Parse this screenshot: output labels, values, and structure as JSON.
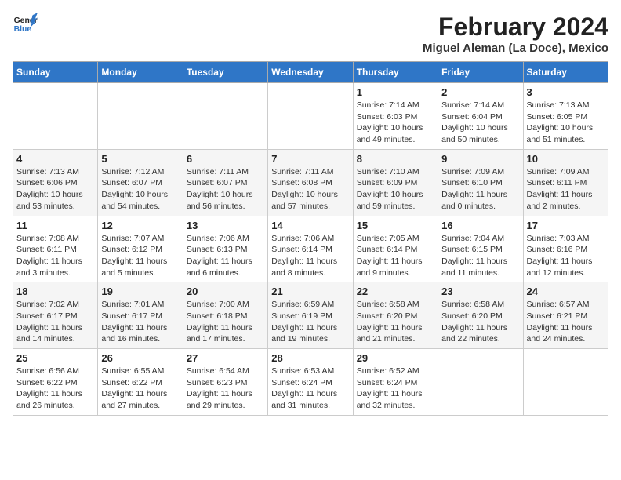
{
  "header": {
    "logo_line1": "General",
    "logo_line2": "Blue",
    "month": "February 2024",
    "location": "Miguel Aleman (La Doce), Mexico"
  },
  "weekdays": [
    "Sunday",
    "Monday",
    "Tuesday",
    "Wednesday",
    "Thursday",
    "Friday",
    "Saturday"
  ],
  "weeks": [
    [
      {
        "day": "",
        "info": ""
      },
      {
        "day": "",
        "info": ""
      },
      {
        "day": "",
        "info": ""
      },
      {
        "day": "",
        "info": ""
      },
      {
        "day": "1",
        "info": "Sunrise: 7:14 AM\nSunset: 6:03 PM\nDaylight: 10 hours\nand 49 minutes."
      },
      {
        "day": "2",
        "info": "Sunrise: 7:14 AM\nSunset: 6:04 PM\nDaylight: 10 hours\nand 50 minutes."
      },
      {
        "day": "3",
        "info": "Sunrise: 7:13 AM\nSunset: 6:05 PM\nDaylight: 10 hours\nand 51 minutes."
      }
    ],
    [
      {
        "day": "4",
        "info": "Sunrise: 7:13 AM\nSunset: 6:06 PM\nDaylight: 10 hours\nand 53 minutes."
      },
      {
        "day": "5",
        "info": "Sunrise: 7:12 AM\nSunset: 6:07 PM\nDaylight: 10 hours\nand 54 minutes."
      },
      {
        "day": "6",
        "info": "Sunrise: 7:11 AM\nSunset: 6:07 PM\nDaylight: 10 hours\nand 56 minutes."
      },
      {
        "day": "7",
        "info": "Sunrise: 7:11 AM\nSunset: 6:08 PM\nDaylight: 10 hours\nand 57 minutes."
      },
      {
        "day": "8",
        "info": "Sunrise: 7:10 AM\nSunset: 6:09 PM\nDaylight: 10 hours\nand 59 minutes."
      },
      {
        "day": "9",
        "info": "Sunrise: 7:09 AM\nSunset: 6:10 PM\nDaylight: 11 hours\nand 0 minutes."
      },
      {
        "day": "10",
        "info": "Sunrise: 7:09 AM\nSunset: 6:11 PM\nDaylight: 11 hours\nand 2 minutes."
      }
    ],
    [
      {
        "day": "11",
        "info": "Sunrise: 7:08 AM\nSunset: 6:11 PM\nDaylight: 11 hours\nand 3 minutes."
      },
      {
        "day": "12",
        "info": "Sunrise: 7:07 AM\nSunset: 6:12 PM\nDaylight: 11 hours\nand 5 minutes."
      },
      {
        "day": "13",
        "info": "Sunrise: 7:06 AM\nSunset: 6:13 PM\nDaylight: 11 hours\nand 6 minutes."
      },
      {
        "day": "14",
        "info": "Sunrise: 7:06 AM\nSunset: 6:14 PM\nDaylight: 11 hours\nand 8 minutes."
      },
      {
        "day": "15",
        "info": "Sunrise: 7:05 AM\nSunset: 6:14 PM\nDaylight: 11 hours\nand 9 minutes."
      },
      {
        "day": "16",
        "info": "Sunrise: 7:04 AM\nSunset: 6:15 PM\nDaylight: 11 hours\nand 11 minutes."
      },
      {
        "day": "17",
        "info": "Sunrise: 7:03 AM\nSunset: 6:16 PM\nDaylight: 11 hours\nand 12 minutes."
      }
    ],
    [
      {
        "day": "18",
        "info": "Sunrise: 7:02 AM\nSunset: 6:17 PM\nDaylight: 11 hours\nand 14 minutes."
      },
      {
        "day": "19",
        "info": "Sunrise: 7:01 AM\nSunset: 6:17 PM\nDaylight: 11 hours\nand 16 minutes."
      },
      {
        "day": "20",
        "info": "Sunrise: 7:00 AM\nSunset: 6:18 PM\nDaylight: 11 hours\nand 17 minutes."
      },
      {
        "day": "21",
        "info": "Sunrise: 6:59 AM\nSunset: 6:19 PM\nDaylight: 11 hours\nand 19 minutes."
      },
      {
        "day": "22",
        "info": "Sunrise: 6:58 AM\nSunset: 6:20 PM\nDaylight: 11 hours\nand 21 minutes."
      },
      {
        "day": "23",
        "info": "Sunrise: 6:58 AM\nSunset: 6:20 PM\nDaylight: 11 hours\nand 22 minutes."
      },
      {
        "day": "24",
        "info": "Sunrise: 6:57 AM\nSunset: 6:21 PM\nDaylight: 11 hours\nand 24 minutes."
      }
    ],
    [
      {
        "day": "25",
        "info": "Sunrise: 6:56 AM\nSunset: 6:22 PM\nDaylight: 11 hours\nand 26 minutes."
      },
      {
        "day": "26",
        "info": "Sunrise: 6:55 AM\nSunset: 6:22 PM\nDaylight: 11 hours\nand 27 minutes."
      },
      {
        "day": "27",
        "info": "Sunrise: 6:54 AM\nSunset: 6:23 PM\nDaylight: 11 hours\nand 29 minutes."
      },
      {
        "day": "28",
        "info": "Sunrise: 6:53 AM\nSunset: 6:24 PM\nDaylight: 11 hours\nand 31 minutes."
      },
      {
        "day": "29",
        "info": "Sunrise: 6:52 AM\nSunset: 6:24 PM\nDaylight: 11 hours\nand 32 minutes."
      },
      {
        "day": "",
        "info": ""
      },
      {
        "day": "",
        "info": ""
      }
    ]
  ]
}
